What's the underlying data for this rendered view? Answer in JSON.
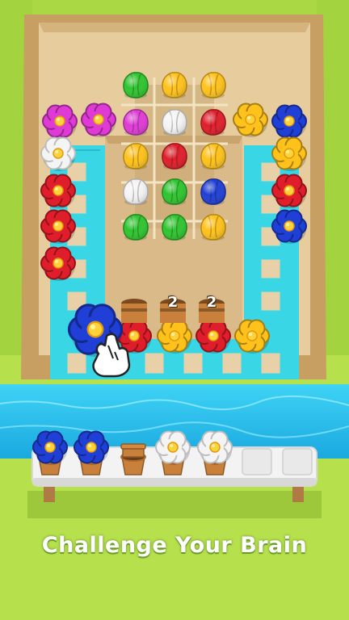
{
  "banner": {
    "text": "Challenge Your Brain"
  },
  "pot_counters": [
    "2",
    "2"
  ],
  "colors": {
    "grass": "#b6e04c",
    "board": "#e3c89a",
    "board_wall": "#c9a36a",
    "conveyor": "#39d6e6",
    "water": "#28c7ef",
    "tray": "#f2f2f2",
    "pot": "#c9803a",
    "red": "#e01d2a",
    "yellow": "#ffc21a",
    "green": "#2ec52e",
    "white": "#f4f4f4",
    "blue": "#1f3fd6",
    "magenta": "#e03ad6"
  },
  "bud_grid": [
    [
      "green",
      "yellow",
      "yellow"
    ],
    [
      "magenta",
      "white",
      "red"
    ],
    [
      "yellow",
      "red",
      "yellow"
    ],
    [
      "white",
      "green",
      "blue"
    ],
    [
      "green",
      "green",
      "yellow"
    ]
  ],
  "left_column_flowers": [
    "magenta",
    "magenta",
    "white",
    "red",
    "red",
    "red"
  ],
  "right_column_flowers": [
    "yellow",
    "blue",
    "yellow",
    "red",
    "blue"
  ],
  "bottom_row_flowers": [
    "blue",
    "red",
    "yellow",
    "red",
    "yellow"
  ],
  "tray_slots": [
    {
      "state": "flower",
      "color": "blue"
    },
    {
      "state": "flower",
      "color": "blue"
    },
    {
      "state": "empty_pot"
    },
    {
      "state": "flower",
      "color": "white"
    },
    {
      "state": "flower",
      "color": "white"
    },
    {
      "state": "empty"
    },
    {
      "state": "empty"
    }
  ],
  "hand_cursor": "pointing-hand-icon"
}
